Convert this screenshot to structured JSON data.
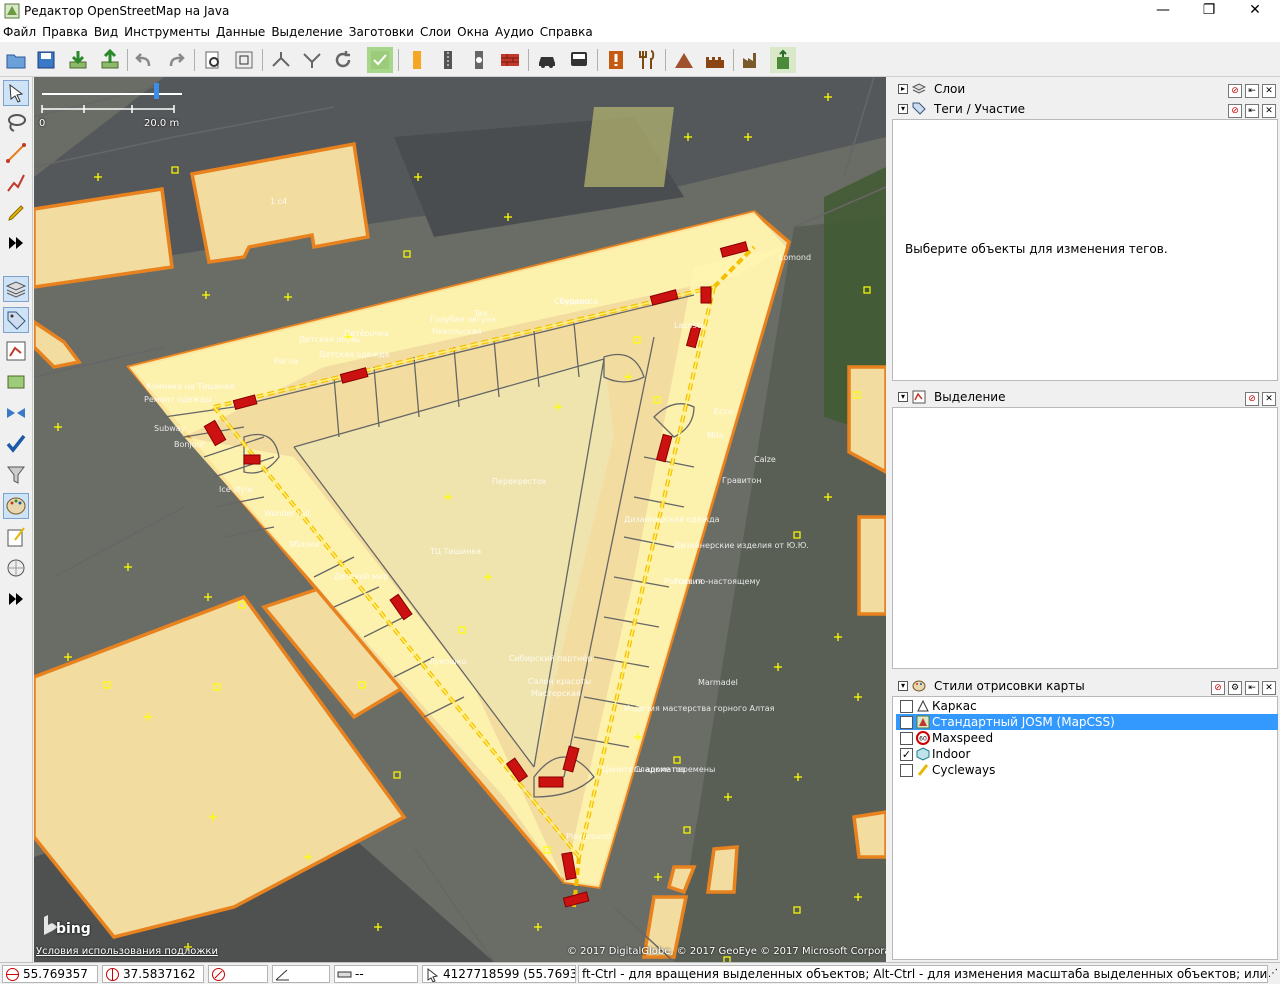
{
  "window": {
    "title": "Редактор OpenStreetMap на Java",
    "minimize": "—",
    "maximize": "❐",
    "close": "✕"
  },
  "menu": [
    "Файл",
    "Правка",
    "Вид",
    "Инструменты",
    "Данные",
    "Выделение",
    "Заготовки",
    "Слои",
    "Окна",
    "Аудио",
    "Справка"
  ],
  "map": {
    "scale_start": "0",
    "scale_end": "20.0 m",
    "attribution_left": "Условия использования подложки",
    "attribution_right": "© 2017 DigitalGlobe, © 2017 GeoEye © 2017 Microsoft Corporation",
    "bing_logo": "bing",
    "labels": [
      "Перекресток",
      "ТЦ Тишинка",
      "Subway",
      "Bonjour",
      "Ice style",
      "Wonder tail",
      "Яблоки",
      "Playground",
      "Marmadel",
      "Сибирский партнёр",
      "Lacoste",
      "Mila",
      "Calze",
      "Ecco",
      "Гравитон",
      "Детская одежда",
      "Детская обувь",
      "Ригла",
      "Пятёрочка",
      "Клиника на Тишинке",
      "Ремонт одежды",
      "Детский мир",
      "Лукошко",
      "Сберкасса",
      "Россия",
      "Салон красоты",
      "Мастерская",
      "Изделия мастерства горного Алтая",
      "Дизайнерская одежда",
      "Дизайнерские изделия от Ю.Ю.",
      "Россия по-настоящему",
      "Сладкие перемены",
      "Ценитель ароматов",
      "Голубая лагуна",
      "Никольская",
      "Tea",
      "Гудзон",
      "1 с4",
      "Lomond"
    ]
  },
  "panels": {
    "layers": {
      "title": "Слои"
    },
    "tags": {
      "title": "Теги / Участие",
      "empty_message": "Выберите объекты для изменения тегов."
    },
    "selection": {
      "title": "Выделение"
    },
    "styles": {
      "title": "Стили отрисовки карты",
      "items": [
        {
          "label": "Каркас",
          "checked": false,
          "selected": false,
          "icon": "wireframe-icon"
        },
        {
          "label": "Стандартный JOSM (MapCSS)",
          "checked": false,
          "selected": true,
          "icon": "josm-style-icon"
        },
        {
          "label": "Maxspeed",
          "checked": false,
          "selected": false,
          "icon": "speed-limit-icon"
        },
        {
          "label": "Indoor",
          "checked": true,
          "selected": false,
          "icon": "indoor-icon"
        },
        {
          "label": "Cycleways",
          "checked": false,
          "selected": false,
          "icon": "cycleway-icon"
        }
      ]
    }
  },
  "status": {
    "lat": "55.769357",
    "lon": "37.5837162",
    "heading": "",
    "angle": "",
    "distance": "--",
    "object": "4127718599 (55.76935...",
    "message": "ft-Ctrl - для вращения выделенных объектов; Alt-Ctrl - для изменения масштаба выделенных объектов; или для изменения выделения"
  },
  "colors": {
    "building_fill": "#f2dca0",
    "building_stroke": "#e8821e",
    "indoor_fill": "#fff4b0",
    "corridor": "#f5c000",
    "door": "#cc1111",
    "selection": "#3399ff"
  }
}
